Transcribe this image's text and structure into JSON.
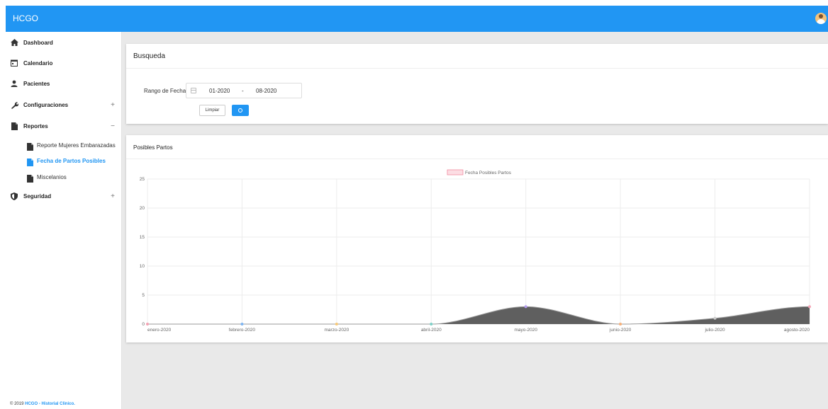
{
  "header": {
    "brand": "HCGO"
  },
  "sidebar": {
    "items": [
      {
        "label": "Dashboard",
        "toggle": ""
      },
      {
        "label": "Calendario",
        "toggle": ""
      },
      {
        "label": "Pacientes",
        "toggle": ""
      },
      {
        "label": "Configuraciones",
        "toggle": "+"
      },
      {
        "label": "Reportes",
        "toggle": "−"
      },
      {
        "label": "Seguridad",
        "toggle": "+"
      }
    ],
    "reportes_sub": [
      {
        "label": "Reporte Mujeres Embarazadas"
      },
      {
        "label": "Fecha de Partos Posibles"
      },
      {
        "label": "Miscelanios"
      }
    ],
    "footer_prefix": "© 2019 ",
    "footer_brand": "HCGO - Historial Clinico."
  },
  "search": {
    "title": "Busqueda",
    "range_label": "Rango de Fecha",
    "date_from": "01-2020",
    "date_sep": "-",
    "date_to": "08-2020",
    "clear_label": "Limpiar"
  },
  "chart_data": {
    "type": "area",
    "title": "Posibles Partos",
    "categories": [
      "enero-2020",
      "febrero-2020",
      "marzo-2020",
      "abril-2020",
      "mayo-2020",
      "junio-2020",
      "julio-2020",
      "agosto-2020"
    ],
    "series": [
      {
        "name": "Fecha Posibles Partos",
        "values": [
          0,
          0,
          0,
          0,
          3,
          0,
          1,
          3
        ]
      }
    ],
    "ylim": [
      0,
      25
    ],
    "yticks": [
      0,
      5,
      10,
      15,
      20,
      25
    ],
    "grid": true,
    "legend": "top-center",
    "colors": {
      "fill": "#5f5f5f",
      "legend_box": "#fcdde3",
      "legend_border": "#f08aa0"
    },
    "point_colors": [
      "#f4a3b4",
      "#7fb6f2",
      "#f7c97a",
      "#7fd1c8",
      "#b49cf0",
      "#f7b07a",
      "#cccccc",
      "#f4a3b4"
    ]
  },
  "colors": {
    "accent": "#2196f3"
  }
}
